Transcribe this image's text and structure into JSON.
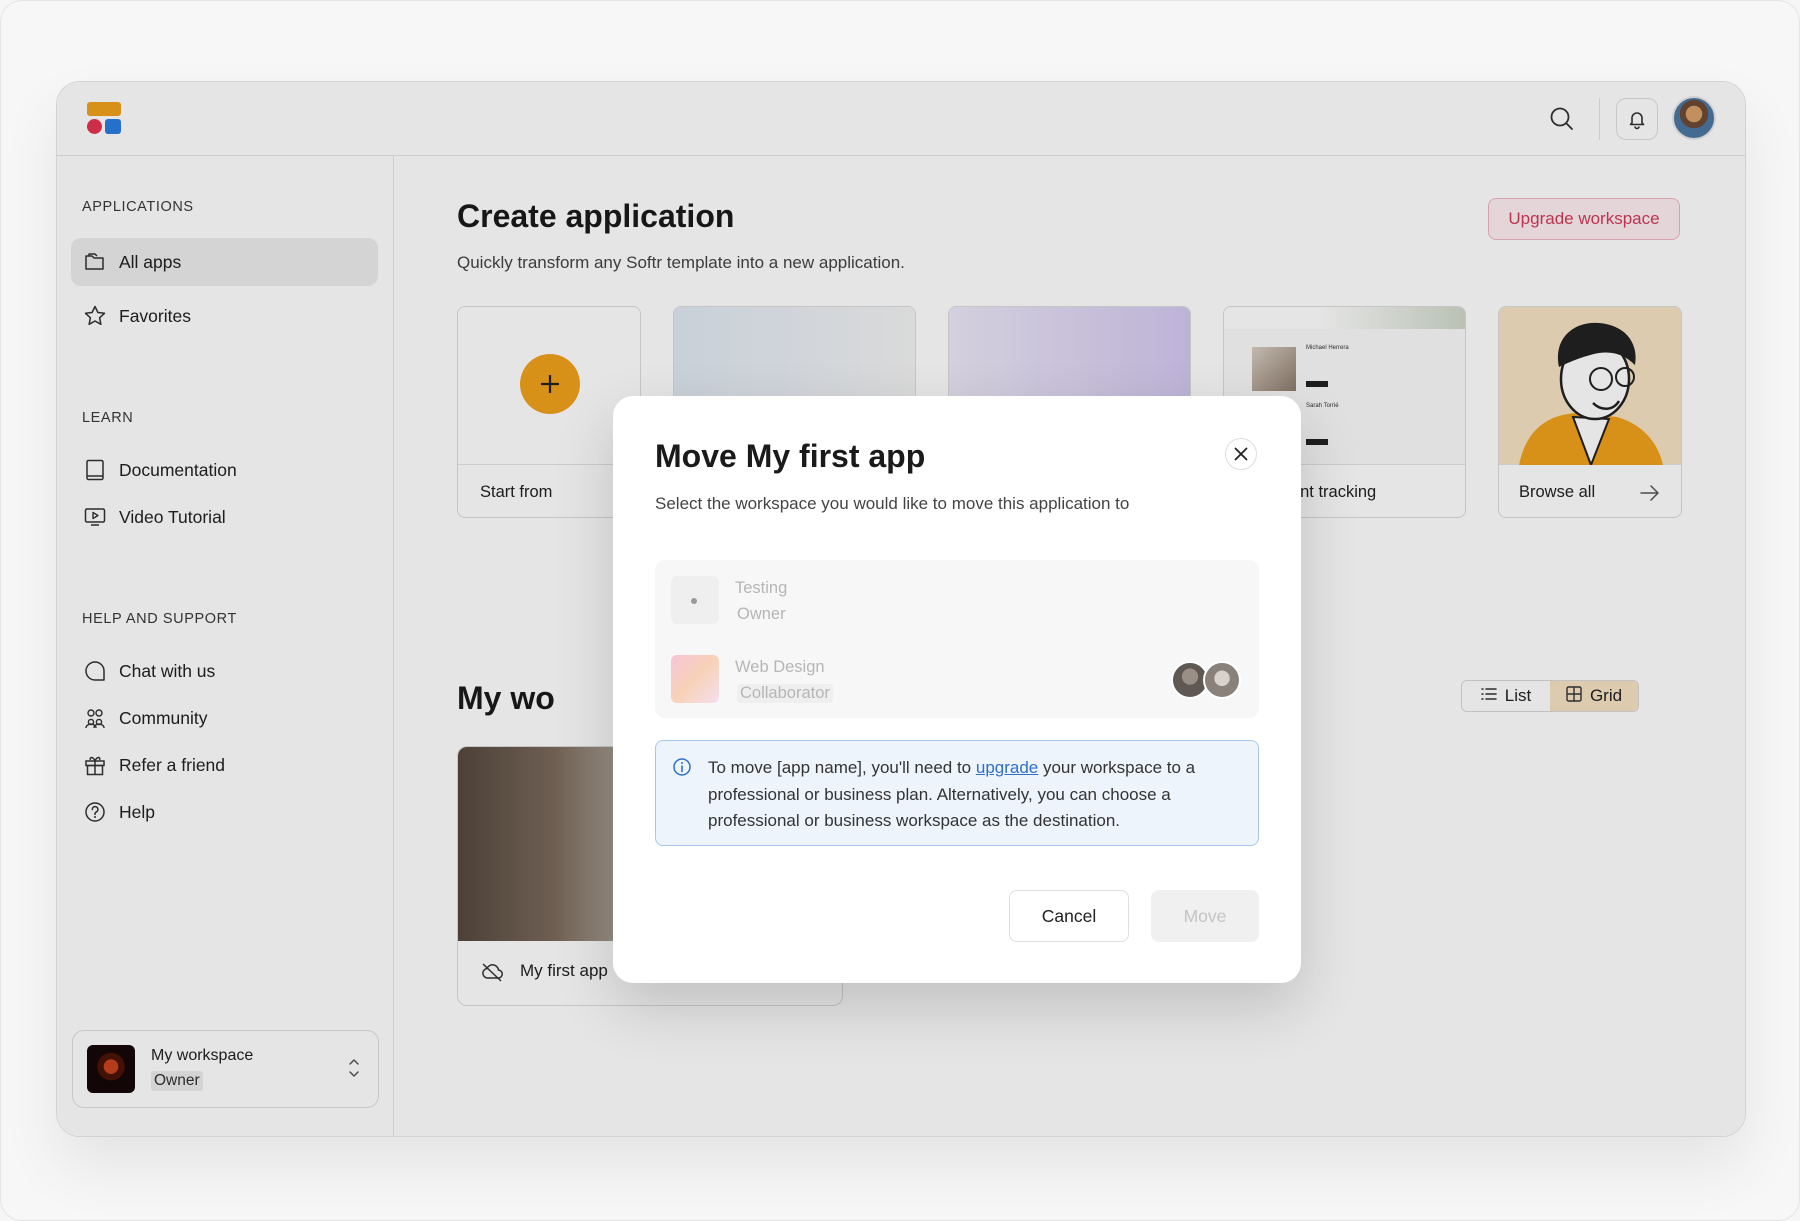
{
  "sidebar": {
    "sections": {
      "applications": "APPLICATIONS",
      "learn": "LEARN",
      "help": "HELP AND SUPPORT"
    },
    "items": {
      "all_apps": "All apps",
      "favorites": "Favorites",
      "documentation": "Documentation",
      "video_tutorial": "Video Tutorial",
      "chat": "Chat with us",
      "community": "Community",
      "refer": "Refer a friend",
      "help": "Help"
    },
    "workspace": {
      "name": "My workspace",
      "role": "Owner"
    }
  },
  "main": {
    "title": "Create application",
    "subtitle": "Quickly transform any Softr template into a new application.",
    "upgrade_label": "Upgrade workspace",
    "templates": {
      "start_from": "Start from",
      "applicant_tracking": "Applicant tracking",
      "browse_all": "Browse all"
    },
    "applicant_preview": {
      "name1": "Michael Herrera",
      "name2": "Sarah Torrié"
    },
    "my_workspace_title": "My wo",
    "view_toggle": {
      "list": "List",
      "grid": "Grid",
      "selected": "Grid"
    },
    "app_card": {
      "name": "My first app"
    }
  },
  "modal": {
    "title": "Move My first app",
    "subtitle": "Select the workspace you would like to move this application to",
    "workspaces": [
      {
        "name": "Testing",
        "role": "Owner"
      },
      {
        "name": "Web Design",
        "role": "Collaborator"
      }
    ],
    "info": {
      "before": "To move [app name], you'll need to ",
      "link": "upgrade",
      "after": " your workspace to a professional or business plan. Alternatively, you can choose a professional or business workspace as the destination."
    },
    "cancel_label": "Cancel",
    "move_label": "Move"
  },
  "colors": {
    "accent_pink": "#d23a5a",
    "info_blue": "#2f6fc9",
    "grid_selected": "#f6e3c4",
    "logo_orange": "#f0a21c",
    "logo_red": "#e63551",
    "logo_blue": "#2a7de1"
  }
}
